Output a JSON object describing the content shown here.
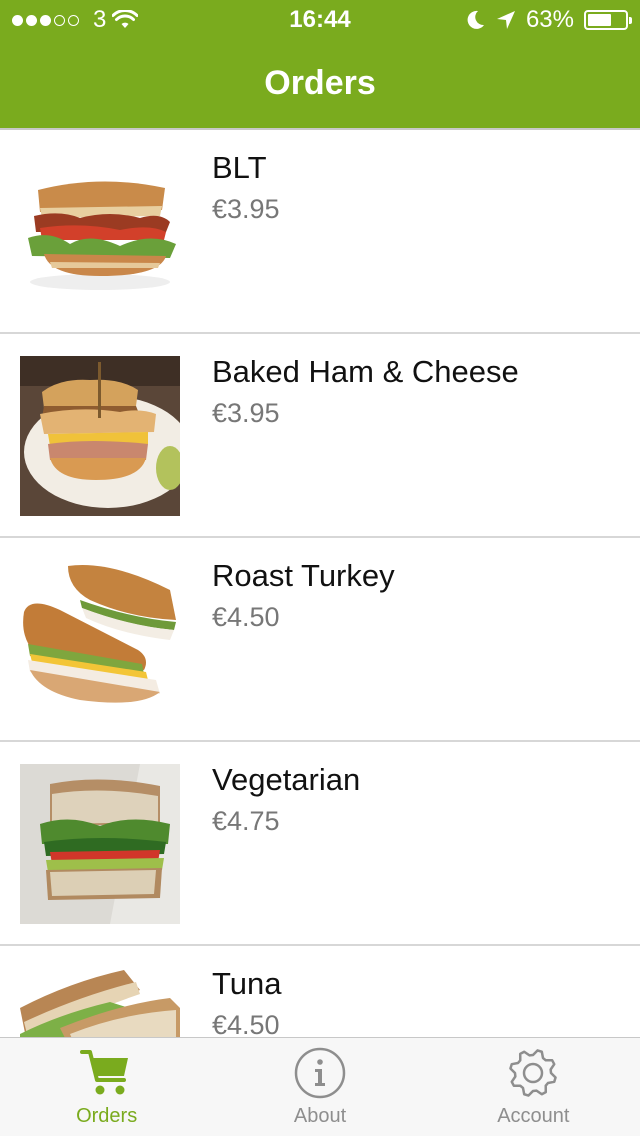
{
  "status_bar": {
    "carrier": "3",
    "time": "16:44",
    "battery": "63%",
    "signal_bars_filled": 3,
    "signal_bars_total": 5,
    "battery_level": 0.63
  },
  "nav": {
    "title": "Orders"
  },
  "items": [
    {
      "name": "BLT",
      "price": "€3.95",
      "image": "blt-sandwich"
    },
    {
      "name": "Baked Ham & Cheese",
      "price": "€3.95",
      "image": "ham-cheese-sandwich"
    },
    {
      "name": "Roast Turkey",
      "price": "€4.50",
      "image": "turkey-baguette"
    },
    {
      "name": "Vegetarian",
      "price": "€4.75",
      "image": "vegetarian-sandwich"
    },
    {
      "name": "Tuna",
      "price": "€4.50",
      "image": "tuna-sandwich"
    }
  ],
  "tabs": [
    {
      "label": "Orders",
      "icon": "cart-icon",
      "active": true
    },
    {
      "label": "About",
      "icon": "info-icon",
      "active": false
    },
    {
      "label": "Account",
      "icon": "gear-icon",
      "active": false
    }
  ],
  "colors": {
    "brand": "#7aab1e",
    "inactive": "#8e8e8e"
  }
}
